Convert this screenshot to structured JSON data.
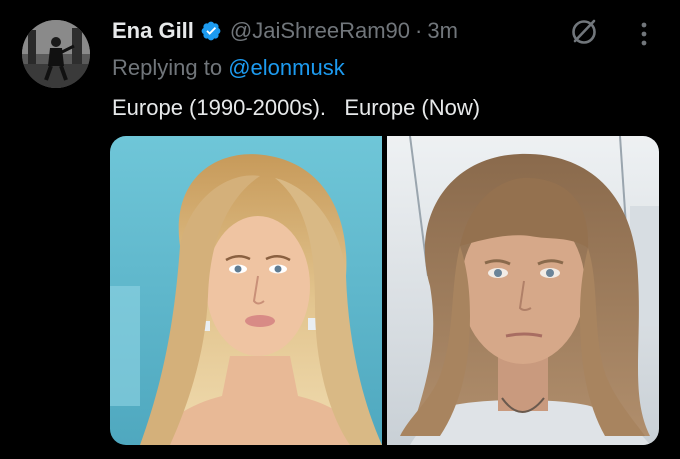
{
  "tweet": {
    "display_name": "Ena Gill",
    "handle": "@JaiShreeRam90",
    "separator": "·",
    "time": "3m",
    "reply_prefix": "Replying to",
    "reply_mention": "@elonmusk",
    "text": "Europe (1990-2000s).   Europe (Now)"
  },
  "icons": {
    "verified": "verified-badge-icon",
    "grok": "grok-icon",
    "more": "more-options-icon"
  },
  "colors": {
    "background": "#000000",
    "text": "#e7e9ea",
    "secondary": "#71767b",
    "accent": "#1d9bf0"
  }
}
